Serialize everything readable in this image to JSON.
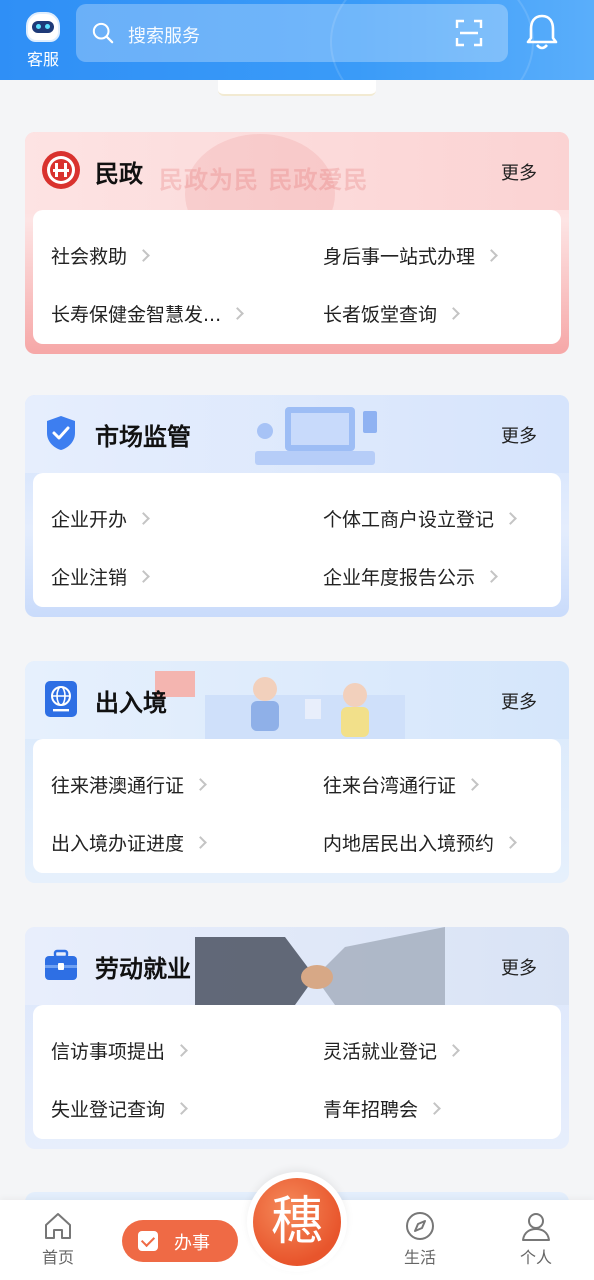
{
  "header": {
    "kefu_label": "客服",
    "search_placeholder": "搜索服务"
  },
  "cards": [
    {
      "title": "民政",
      "more": "更多",
      "watermark": "民政为民 民政爱民",
      "items": [
        "社会救助",
        "身后事一站式办理",
        "长寿保健金智慧发...",
        "长者饭堂查询"
      ]
    },
    {
      "title": "市场监管",
      "more": "更多",
      "items": [
        "企业开办",
        "个体工商户设立登记",
        "企业注销",
        "企业年度报告公示"
      ]
    },
    {
      "title": "出入境",
      "more": "更多",
      "items": [
        "往来港澳通行证",
        "往来台湾通行证",
        "出入境办证进度",
        "内地居民出入境预约"
      ]
    },
    {
      "title": "劳动就业",
      "more": "更多",
      "items": [
        "信访事项提出",
        "灵活就业登记",
        "失业登记查询",
        "青年招聘会"
      ]
    }
  ],
  "bottom_nav": {
    "home": "首页",
    "banshi": "办事",
    "center_glyph": "穗",
    "life": "生活",
    "personal": "个人"
  },
  "colors": {
    "header_blue": "#2f8ff6",
    "accent_orange": "#ef6a45",
    "minzheng_red": "#d9322e"
  }
}
